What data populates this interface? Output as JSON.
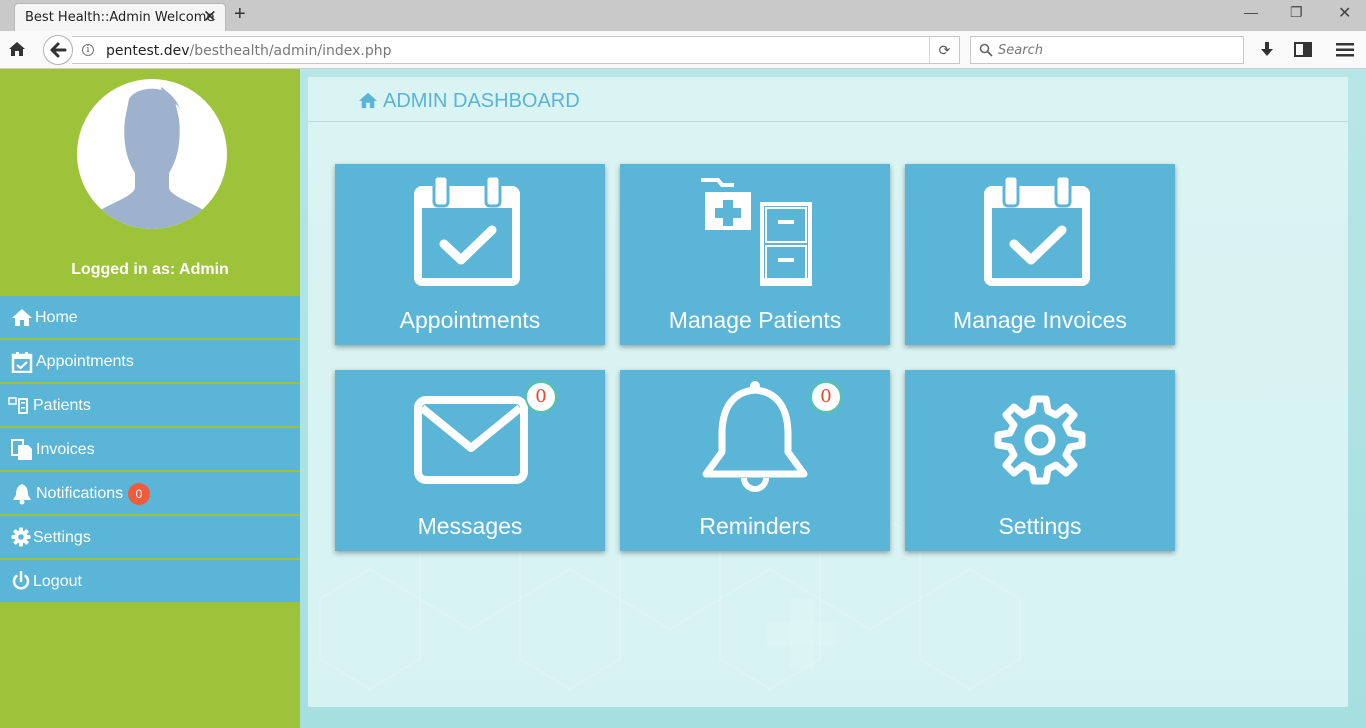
{
  "browser": {
    "tab_title": "Best Health::Admin Welcome",
    "url_host": "pentest.dev",
    "url_path": "/besthealth/admin/index.php",
    "search_placeholder": "Search"
  },
  "sidebar": {
    "logged_in_text": "Logged in as: Admin",
    "items": [
      {
        "label": "Home",
        "icon": "home-icon"
      },
      {
        "label": "Appointments",
        "icon": "calendar-check-icon"
      },
      {
        "label": "Patients",
        "icon": "files-icon"
      },
      {
        "label": "Invoices",
        "icon": "documents-icon"
      },
      {
        "label": "Notifications",
        "icon": "bell-icon",
        "badge": "0"
      },
      {
        "label": "Settings",
        "icon": "gear-icon"
      },
      {
        "label": "Logout",
        "icon": "power-icon"
      }
    ]
  },
  "dashboard": {
    "title": "ADMIN DASHBOARD",
    "cards": [
      {
        "label": "Appointments",
        "icon": "calendar-check-icon"
      },
      {
        "label": "Manage Patients",
        "icon": "patient-files-icon"
      },
      {
        "label": "Manage Invoices",
        "icon": "calendar-check-icon"
      },
      {
        "label": "Messages",
        "icon": "envelope-icon",
        "badge": "0"
      },
      {
        "label": "Reminders",
        "icon": "bell-icon",
        "badge": "0"
      },
      {
        "label": "Settings",
        "icon": "gear-icon"
      }
    ]
  },
  "colors": {
    "sidebar_green": "#9dc33b",
    "tile_blue": "#5bb5d6",
    "badge_red": "#f15a3a"
  }
}
